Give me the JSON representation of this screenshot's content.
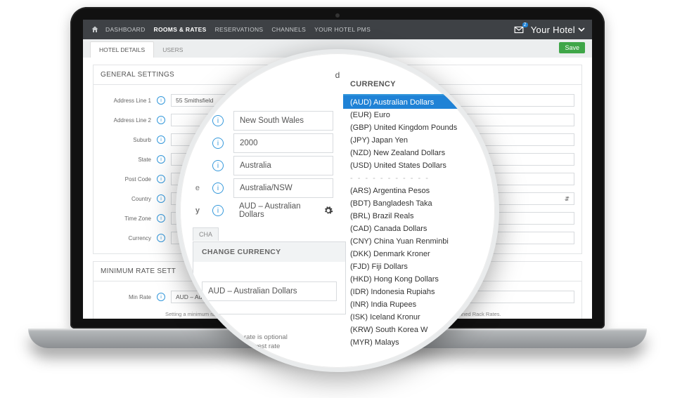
{
  "nav": {
    "items": [
      "DASHBOARD",
      "ROOMS & RATES",
      "RESERVATIONS",
      "CHANNELS",
      "YOUR HOTEL PMS"
    ],
    "active_index": 1,
    "badge_count": "2",
    "hotel_label": "Your Hotel"
  },
  "tabs": {
    "items": [
      "HOTEL DETAILS",
      "USERS"
    ],
    "active_index": 0,
    "save_label": "Save"
  },
  "general": {
    "title": "GENERAL SETTINGS",
    "rows": [
      {
        "label": "Address Line 1",
        "value": "55 Smithsfield"
      },
      {
        "label": "Address Line 2",
        "value": ""
      },
      {
        "label": "Suburb",
        "value": ""
      },
      {
        "label": "State",
        "value": ""
      },
      {
        "label": "Post Code",
        "value": ""
      },
      {
        "label": "Country",
        "value": ""
      },
      {
        "label": "Time Zone",
        "value": ""
      },
      {
        "label": "Currency",
        "value": ""
      }
    ]
  },
  "min_rate": {
    "title": "MINIMUM RATE SETT",
    "row_label": "Min Rate",
    "value_preview": "AUD – Aus",
    "helper": "Setting a minimum rate is optional ... or control panel to be less than this value. This value must be lower than th... m Rates defined Rack Rates."
  },
  "magnified": {
    "top_tail": "d",
    "rows": [
      {
        "value": "New South Wales"
      },
      {
        "value": "2000"
      },
      {
        "value": "Australia"
      },
      {
        "value": "Australia/NSW"
      },
      {
        "value": "AUD – Australian Dollars",
        "gear": true
      }
    ],
    "label_tails": [
      "",
      "",
      "",
      "e",
      "y"
    ],
    "change": {
      "title": "CHANGE CURRENCY",
      "value": "AUD – Australian Dollars"
    },
    "partial_head": "CHA",
    "helper_a": "g a minimum rate is optional",
    "helper_b": "lower than the lowest rate"
  },
  "currency_panel": {
    "title": "CURRENCY",
    "top": [
      "(AUD) Australian Dollars",
      "(EUR) Euro",
      "(GBP) United Kingdom Pounds",
      "(JPY) Japan Yen",
      "(NZD) New Zealand Dollars",
      "(USD) United States Dollars"
    ],
    "selected_index": 0,
    "rest": [
      "(ARS) Argentina Pesos",
      "(BDT) Bangladesh Taka",
      "(BRL) Brazil Reals",
      "(CAD) Canada Dollars",
      "(CNY) China Yuan Renminbi",
      "(DKK) Denmark Kroner",
      "(FJD) Fiji Dollars",
      "(HKD) Hong Kong Dollars",
      "(IDR) Indonesia Rupiahs",
      "(INR) India Rupees",
      "(ISK) Iceland Kronur",
      "(KRW) South Korea W",
      "(MYR) Malays"
    ]
  }
}
